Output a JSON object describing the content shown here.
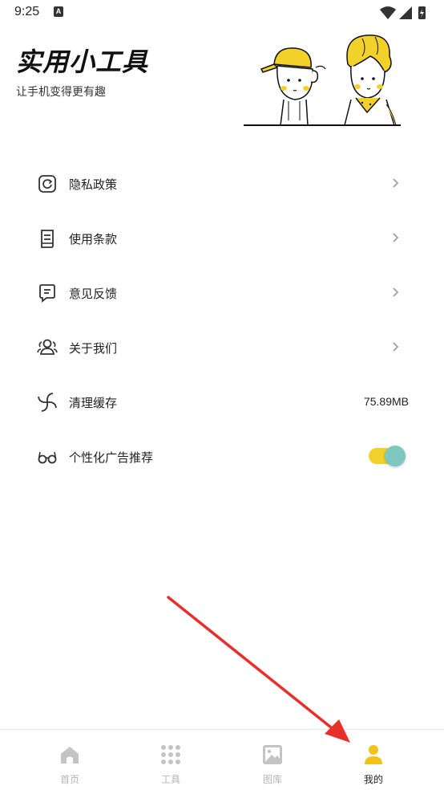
{
  "status_bar": {
    "time": "9:25",
    "notification_badge": "A"
  },
  "header": {
    "title": "实用小工具",
    "subtitle": "让手机变得更有趣"
  },
  "menu": {
    "items": [
      {
        "label": "隐私政策",
        "icon": "privacy-icon"
      },
      {
        "label": "使用条款",
        "icon": "terms-icon"
      },
      {
        "label": "意见反馈",
        "icon": "feedback-icon"
      },
      {
        "label": "关于我们",
        "icon": "about-icon"
      },
      {
        "label": "清理缓存",
        "icon": "clear-cache-icon",
        "value": "75.89MB"
      },
      {
        "label": "个性化广告推荐",
        "icon": "glasses-icon",
        "toggle_on": true
      }
    ]
  },
  "tabs": [
    {
      "label": "首页",
      "icon": "home-icon",
      "active": false
    },
    {
      "label": "工具",
      "icon": "grid-icon",
      "active": false
    },
    {
      "label": "图库",
      "icon": "gallery-icon",
      "active": false
    },
    {
      "label": "我的",
      "icon": "profile-icon",
      "active": true
    }
  ],
  "colors": {
    "accent": "#f2d22a",
    "toggle_knob": "#7ec8c0",
    "annotation": "#e8302a",
    "inactive_tab": "#b5b5b5"
  }
}
